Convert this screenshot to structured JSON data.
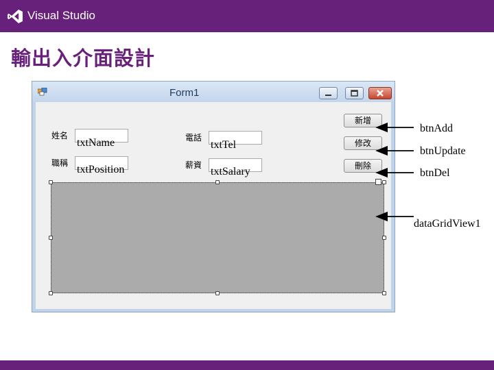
{
  "header": {
    "product_name": "Visual Studio",
    "logo_icon": "visual-studio-logo-icon",
    "bar_color": "#68217a"
  },
  "slide": {
    "title": "輸出入介面設計"
  },
  "form": {
    "title": "Form1",
    "labels": {
      "name": "姓名",
      "tel": "電話",
      "position": "職稱",
      "salary": "薪資"
    },
    "textbox_names": {
      "name": "txtName",
      "tel": "txtTel",
      "position": "txtPosition",
      "salary": "txtSalary"
    },
    "buttons": {
      "add": "新增",
      "update": "修改",
      "delete": "刪除"
    },
    "grid_color": "#ababab"
  },
  "callouts": {
    "add": "btnAdd",
    "update": "btnUpdate",
    "delete": "btnDel",
    "grid": "dataGridView1"
  }
}
